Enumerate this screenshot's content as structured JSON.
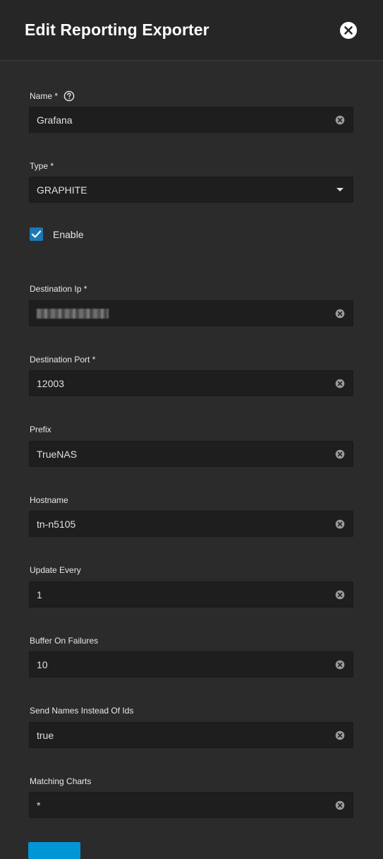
{
  "dialog": {
    "title": "Edit Reporting Exporter",
    "close_icon": "close-icon"
  },
  "fields": {
    "name": {
      "label": "Name *",
      "value": "Grafana",
      "help_icon": "help-icon"
    },
    "type": {
      "label": "Type *",
      "value": "GRAPHITE"
    },
    "enable": {
      "label": "Enable",
      "checked": true,
      "color": "#1b78b5"
    },
    "destination_ip": {
      "label": "Destination Ip *",
      "value": ""
    },
    "destination_port": {
      "label": "Destination Port *",
      "value": "12003"
    },
    "prefix": {
      "label": "Prefix",
      "value": "TrueNAS"
    },
    "hostname": {
      "label": "Hostname",
      "value": "tn-n5105"
    },
    "update_every": {
      "label": "Update Every",
      "value": "1"
    },
    "buffer_on_failures": {
      "label": "Buffer On Failures",
      "value": "10"
    },
    "send_names_instead_of_ids": {
      "label": "Send Names Instead Of Ids",
      "value": "true"
    },
    "matching_charts": {
      "label": "Matching Charts",
      "value": "*"
    }
  },
  "colors": {
    "background": "#2b2b2b",
    "header": "#262626",
    "input": "#1e1e1e",
    "accent": "#0095d5"
  }
}
